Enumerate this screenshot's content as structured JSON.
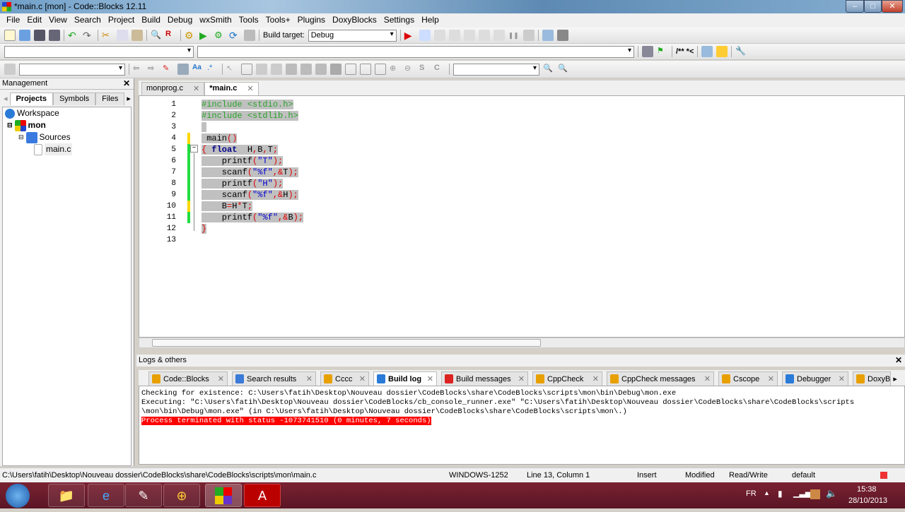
{
  "window": {
    "title": "*main.c [mon] - Code::Blocks 12.11"
  },
  "menu": [
    "File",
    "Edit",
    "View",
    "Search",
    "Project",
    "Build",
    "Debug",
    "wxSmith",
    "Tools",
    "Tools+",
    "Plugins",
    "DoxyBlocks",
    "Settings",
    "Help"
  ],
  "toolbar": {
    "build_target_label": "Build target:",
    "build_target_value": "Debug",
    "comment_label": "/** *<"
  },
  "management": {
    "title": "Management",
    "tabs": [
      "Projects",
      "Symbols",
      "Files"
    ],
    "tree": [
      "Workspace",
      "mon",
      "Sources",
      "main.c"
    ]
  },
  "editor": {
    "tabs": [
      "monprog.c",
      "*main.c"
    ],
    "markers": [
      "",
      "",
      "",
      "yellow",
      "green",
      "green",
      "green",
      "green",
      "green",
      "yellow",
      "green",
      "",
      ""
    ],
    "lines": [
      [
        [
          "#include <stdio.h>",
          "pp"
        ]
      ],
      [
        [
          "#include <stdlib.h>",
          "pp"
        ]
      ],
      [
        [
          " ",
          "df"
        ]
      ],
      [
        [
          " main",
          "df"
        ],
        [
          "()",
          "op"
        ]
      ],
      [
        [
          "{",
          "op"
        ],
        [
          " float",
          "kw"
        ],
        [
          "  H",
          "df"
        ],
        [
          ",",
          "op"
        ],
        [
          "B",
          "df"
        ],
        [
          ",",
          "op"
        ],
        [
          "T",
          "df"
        ],
        [
          ";",
          "op"
        ]
      ],
      [
        [
          "    printf",
          "df"
        ],
        [
          "(",
          "op"
        ],
        [
          "\"T\"",
          "st"
        ],
        [
          ");",
          "op"
        ]
      ],
      [
        [
          "    scanf",
          "df"
        ],
        [
          "(",
          "op"
        ],
        [
          "\"%f\"",
          "st"
        ],
        [
          ",&",
          "op"
        ],
        [
          "T",
          "df"
        ],
        [
          ");",
          "op"
        ]
      ],
      [
        [
          "    printf",
          "df"
        ],
        [
          "(",
          "op"
        ],
        [
          "\"H\"",
          "st"
        ],
        [
          ");",
          "op"
        ]
      ],
      [
        [
          "    scanf",
          "df"
        ],
        [
          "(",
          "op"
        ],
        [
          "\"%f\"",
          "st"
        ],
        [
          ",&",
          "op"
        ],
        [
          "H",
          "df"
        ],
        [
          ");",
          "op"
        ]
      ],
      [
        [
          "    B",
          "df"
        ],
        [
          "=",
          "op"
        ],
        [
          "H",
          "df"
        ],
        [
          "*",
          "op"
        ],
        [
          "T",
          "df"
        ],
        [
          ";",
          "op"
        ]
      ],
      [
        [
          "    printf",
          "df"
        ],
        [
          "(",
          "op"
        ],
        [
          "\"%f\"",
          "st"
        ],
        [
          ",&",
          "op"
        ],
        [
          "B",
          "df"
        ],
        [
          ");",
          "op"
        ]
      ],
      [
        [
          "}",
          "op"
        ]
      ],
      []
    ]
  },
  "logs": {
    "title": "Logs & others",
    "tabs": [
      "Code::Blocks",
      "Search results",
      "Cccc",
      "Build log",
      "Build messages",
      "CppCheck",
      "CppCheck messages",
      "Cscope",
      "Debugger",
      "DoxyB"
    ],
    "lines": [
      "Checking for existence: C:\\Users\\fatih\\Desktop\\Nouveau dossier\\CodeBlocks\\share\\CodeBlocks\\scripts\\mon\\bin\\Debug\\mon.exe",
      "Executing: \"C:\\Users\\fatih\\Desktop\\Nouveau dossier\\CodeBlocks/cb_console_runner.exe\" \"C:\\Users\\fatih\\Desktop\\Nouveau dossier\\CodeBlocks\\share\\CodeBlocks\\scripts",
      "\\mon\\bin\\Debug\\mon.exe\"  (in C:\\Users\\fatih\\Desktop\\Nouveau dossier\\CodeBlocks\\share\\CodeBlocks\\scripts\\mon\\.)"
    ],
    "error": "Process terminated with status -1073741510 (0 minutes, 7 seconds)"
  },
  "status": {
    "path": "C:\\Users\\fatih\\Desktop\\Nouveau dossier\\CodeBlocks\\share\\CodeBlocks\\scripts\\mon\\main.c",
    "encoding": "WINDOWS-1252",
    "position": "Line 13, Column 1",
    "mode": "Insert",
    "modified": "Modified",
    "access": "Read/Write",
    "profile": "default"
  },
  "taskbar": {
    "lang": "FR",
    "time": "15:38",
    "date": "28/10/2013"
  },
  "colors": {
    "marker_green": "#22dd44",
    "marker_yellow": "#ffd700",
    "error_bg": "#ff0000",
    "taskbar": "#6a1a2a"
  }
}
